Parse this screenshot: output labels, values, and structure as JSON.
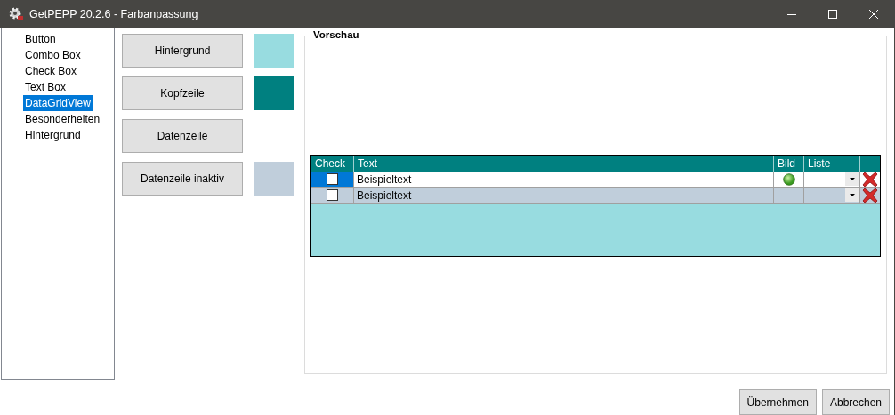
{
  "window": {
    "title": "GetPEPP 20.2.6 - Farbanpassung"
  },
  "tree": {
    "items": [
      {
        "label": "Button",
        "selected": false
      },
      {
        "label": "Combo Box",
        "selected": false
      },
      {
        "label": "Check Box",
        "selected": false
      },
      {
        "label": "Text Box",
        "selected": false
      },
      {
        "label": "DataGridView",
        "selected": true
      },
      {
        "label": "Besonderheiten",
        "selected": false
      },
      {
        "label": "Hintergrund",
        "selected": false
      }
    ]
  },
  "color_buttons": [
    {
      "label": "Hintergrund",
      "color": "#98dce0"
    },
    {
      "label": "Kopfzeile",
      "color": "#008080"
    },
    {
      "label": "Datenzeile"
    },
    {
      "label": "Datenzeile inaktiv",
      "color": "#c0cedb"
    }
  ],
  "preview": {
    "title": "Vorschau",
    "grid": {
      "columns": [
        "Check",
        "Text",
        "Bild",
        "Liste"
      ],
      "rows": [
        {
          "checked": false,
          "text": "Beispieltext",
          "selected": true,
          "active": true,
          "has_image": true
        },
        {
          "checked": false,
          "text": "Beispieltext",
          "selected": false,
          "active": false,
          "has_image": false
        }
      ]
    }
  },
  "buttons": [
    "Übernehmen",
    "Abbrechen"
  ]
}
